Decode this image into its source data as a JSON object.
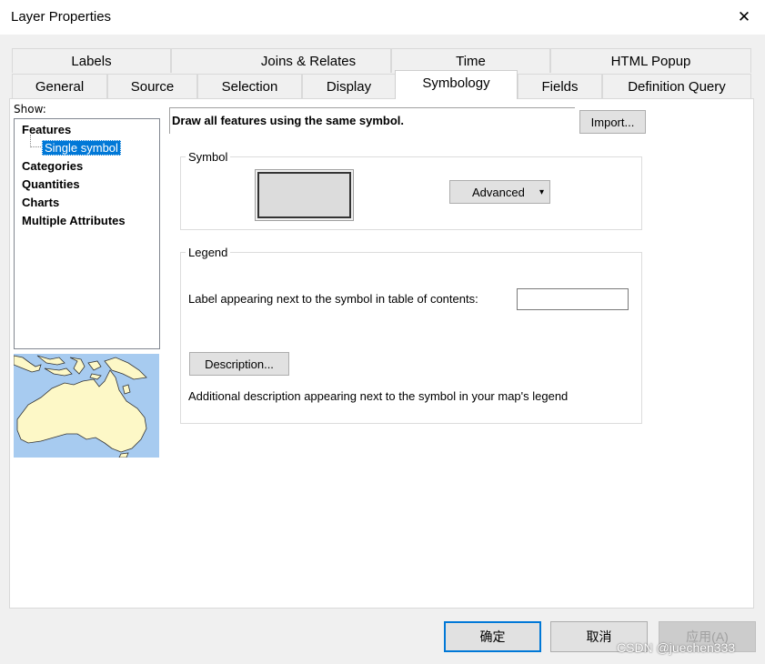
{
  "window": {
    "title": "Layer Properties",
    "close_glyph": "✕"
  },
  "tabs_row1": [
    "Labels",
    "Joins & Relates",
    "Time",
    "HTML Popup"
  ],
  "tabs_row2": [
    "General",
    "Source",
    "Selection",
    "Display",
    "Symbology",
    "Fields",
    "Definition Query"
  ],
  "active_tab": "Symbology",
  "show_label": "Show:",
  "show_tree": {
    "features": "Features",
    "single_symbol": "Single symbol",
    "categories": "Categories",
    "quantities": "Quantities",
    "charts": "Charts",
    "multiple_attributes": "Multiple Attributes"
  },
  "header": {
    "description": "Draw all features using the same symbol.",
    "import_button": "Import..."
  },
  "symbol": {
    "group_title": "Symbol",
    "advanced_button": "Advanced",
    "advanced_arrow": "▾"
  },
  "legend": {
    "group_title": "Legend",
    "label_prompt": "Label appearing next to the symbol in table of contents:",
    "label_value": "",
    "description_button": "Description...",
    "additional_description": "Additional description appearing next to the symbol in your map's legend"
  },
  "footer": {
    "ok": "确定",
    "cancel": "取消",
    "apply": "应用(A)"
  },
  "watermark": "CSDN @juechen333",
  "colors": {
    "selection": "#0078d7",
    "map_water": "#a7cbf0",
    "map_land": "#fdf8c7"
  }
}
